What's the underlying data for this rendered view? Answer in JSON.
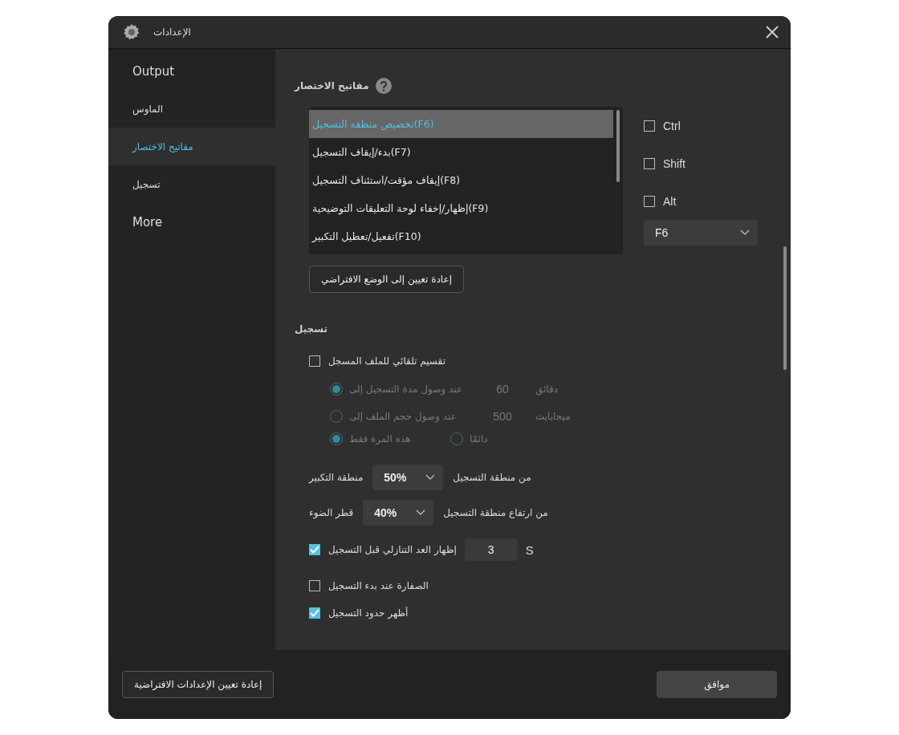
{
  "window": {
    "title": "الإعدادات"
  },
  "sidebar": {
    "items": [
      {
        "label": "Output",
        "selected": false
      },
      {
        "label": "الماوس",
        "selected": false
      },
      {
        "label": "مفاتيح الاختصار",
        "selected": true
      },
      {
        "label": "تسجيل",
        "selected": false
      },
      {
        "label": "More",
        "selected": false
      }
    ]
  },
  "shortcuts": {
    "title": "مفاتيح الاختصار",
    "actions": [
      {
        "label": "(F6)تخصيص منطقة التسجيل",
        "selected": true
      },
      {
        "label": "(F7)بدء/إيقاف التسجيل",
        "selected": false
      },
      {
        "label": "(F8)إيقاف مؤقت/استئناف التسجيل",
        "selected": false
      },
      {
        "label": "(F9)إظهار/إخفاء لوحة التعليقات التوضيحية",
        "selected": false
      },
      {
        "label": "(F10)تفعيل/تعطيل التكبير",
        "selected": false
      }
    ],
    "modifiers": [
      {
        "label": "Ctrl",
        "checked": false
      },
      {
        "label": "Shift",
        "checked": false
      },
      {
        "label": "Alt",
        "checked": false
      }
    ],
    "key": "F6",
    "reset_button": "إعادة تعيين إلى الوضع الافتراضي"
  },
  "recording": {
    "title": "تسجيل",
    "auto_split": {
      "label": "تقسيم تلقائي للملف المسجل",
      "checked": false,
      "disabled": true
    },
    "split_options": [
      {
        "label": "عند وصول مدة التسجيل إلى",
        "value": "60",
        "unit": "دقائق",
        "selected": true
      },
      {
        "label": "عند وصول حجم الملف إلى",
        "value": "500",
        "unit": "ميجابايت",
        "selected": false
      }
    ],
    "frequency": [
      {
        "label": "دائمًا",
        "selected": false
      },
      {
        "label": "هذه المرة فقط",
        "selected": true
      }
    ],
    "zoom_area": {
      "left_label": "منطقة التكبير",
      "value": "50%",
      "right_label": "من منطقة التسجيل"
    },
    "spotlight": {
      "left_label": "قطر الضوء",
      "value": "40%",
      "right_label": "من ارتفاع منطقة التسجيل"
    },
    "countdown": {
      "label": "إظهار العد التنازلي قبل التسجيل",
      "checked": true,
      "value": "3",
      "unit": "S"
    },
    "options": [
      {
        "label": "الصفارة عند بدء التسجيل",
        "checked": false
      },
      {
        "label": "أظهر حدود التسجيل",
        "checked": true
      }
    ]
  },
  "footer": {
    "reset_all_button": "إعادة تعيين الإعدادات الافتراضية",
    "ok_button": "موافق"
  }
}
